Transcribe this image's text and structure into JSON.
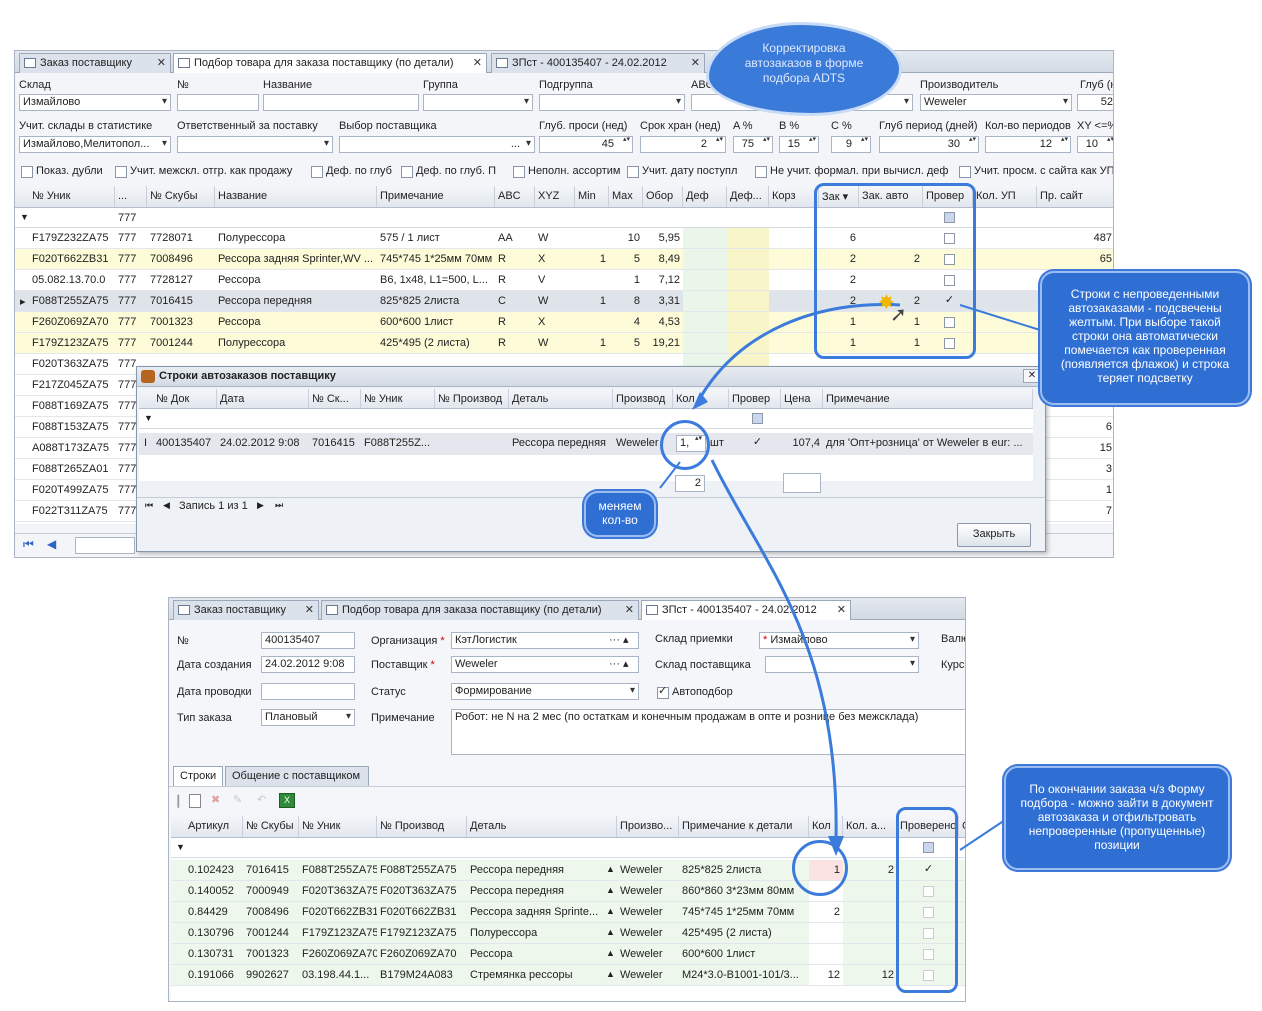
{
  "top_window": {
    "tabs": [
      {
        "label": "Заказ поставщику"
      },
      {
        "label": "Подбор товара для заказа поставщику (по детали)"
      },
      {
        "label": "ЗПст - 400135407 - 24.02.2012"
      }
    ],
    "filters": {
      "sklad_label": "Склад",
      "sklad_value": "Измайлово",
      "num_label": "№",
      "name_label": "Название",
      "group_label": "Группа",
      "subgroup_label": "Подгруппа",
      "abc_label": "ABC",
      "producer_label": "Производитель",
      "producer_value": "Weweler",
      "depth_label": "Глуб (н",
      "depth_value": "52",
      "stat_label": "Учит. склады в статистике",
      "stat_value": "Измайлово,Мелитопол...",
      "resp_label": "Ответственный за поставку",
      "supplier_label": "Выбор поставщика",
      "supplier_value": "...",
      "glub_label": "Глуб. проси (нед)",
      "glub_value": "45",
      "srok_label": "Срок хран (нед)",
      "srok_value": "2",
      "a_label": "A %",
      "a_value": "75",
      "b_label": "B %",
      "b_value": "15",
      "c_label": "C %",
      "c_value": "9",
      "period_label": "Глуб период (дней)",
      "period_value": "30",
      "periods_label": "Кол-во периодов",
      "periods_value": "12",
      "xy_label": "XY <=%",
      "xy_value": "10"
    },
    "checkboxes": [
      "Показ. дубли",
      "Учит. межскл. отгр. как продажу",
      "Деф. по глуб",
      "Деф. по глуб. П",
      "Неполн. ассортим",
      "Учит. дату поступл",
      "Не учит. формал. при вычисл. деф",
      "Учит. просм. с сайта как УП"
    ],
    "grid": {
      "headers": [
        "№ Уник",
        "...",
        "№ Скубы",
        "Название",
        "Примечание",
        "ABC",
        "XYZ",
        "Min",
        "Max",
        "Обор",
        "Деф",
        "Деф...",
        "Корз",
        "Зак",
        "Зак. авто",
        "Провер",
        "Кол. УП",
        "Пр. сайт"
      ],
      "filter_value": "777",
      "rows": [
        {
          "uid": "F179Z232ZA75",
          "n": "777",
          "sku": "7728071",
          "name": "Полурессора",
          "note": "575 / 1 лист",
          "abc": "AA",
          "xyz": "W",
          "min": "",
          "max": "10",
          "obor": "5,95",
          "zak": "6",
          "auto": "",
          "check": false,
          "site": "487"
        },
        {
          "uid": "F020T662ZB31",
          "n": "777",
          "sku": "7008496",
          "name": "Рессора задняя Sprinter,WV ...",
          "note": "745*745 1*25мм 70мм",
          "abc": "R",
          "xyz": "X",
          "min": "1",
          "max": "5",
          "obor": "8,49",
          "zak": "2",
          "auto": "2",
          "check": false,
          "site": "65"
        },
        {
          "uid": "05.082.13.70.0",
          "n": "777",
          "sku": "7728127",
          "name": "Рессора",
          "note": "B6, 1x48, L1=500, L...",
          "abc": "R",
          "xyz": "V",
          "min": "",
          "max": "1",
          "obor": "7,12",
          "zak": "2",
          "auto": "",
          "check": false,
          "site": ""
        },
        {
          "uid": "F088T255ZA75",
          "n": "777",
          "sku": "7016415",
          "name": "Рессора передняя",
          "note": "825*825 2листа",
          "abc": "C",
          "xyz": "W",
          "min": "1",
          "max": "8",
          "obor": "3,31",
          "zak": "2",
          "auto": "2",
          "check": true,
          "site": ""
        },
        {
          "uid": "F260Z069ZA70",
          "n": "777",
          "sku": "7001323",
          "name": "Рессора",
          "note": "600*600 1лист",
          "abc": "R",
          "xyz": "X",
          "min": "",
          "max": "4",
          "obor": "4,53",
          "zak": "1",
          "auto": "1",
          "check": false,
          "site": ""
        },
        {
          "uid": "F179Z123ZA75",
          "n": "777",
          "sku": "7001244",
          "name": "Полурессора",
          "note": "425*495 (2 листа)",
          "abc": "R",
          "xyz": "W",
          "min": "1",
          "max": "5",
          "obor": "19,21",
          "zak": "1",
          "auto": "1",
          "check": false,
          "site": ""
        },
        {
          "uid": "F020T363ZA75",
          "n": "777",
          "site": ""
        },
        {
          "uid": "F217Z045ZA75",
          "n": "777",
          "site": ""
        },
        {
          "uid": "F088T169ZA75",
          "n": "777",
          "site": ""
        },
        {
          "uid": "F088T153ZA75",
          "n": "777",
          "site": "6"
        },
        {
          "uid": "A088T173ZA75",
          "n": "777",
          "site": "15"
        },
        {
          "uid": "F088T265ZA01",
          "n": "777",
          "site": "3"
        },
        {
          "uid": "F020T499ZA75",
          "n": "777",
          "site": "1"
        },
        {
          "uid": "F022T311ZA75",
          "n": "777",
          "site": "7"
        }
      ]
    }
  },
  "dialog": {
    "title": "Строки автозаказов поставщику",
    "headers": [
      "№ Док",
      "Дата",
      "№ Ск...",
      "№ Уник",
      "№ Производ",
      "Деталь",
      "Производ",
      "Кол",
      "Провер",
      "Цена",
      "Примечание"
    ],
    "row": {
      "doc": "400135407",
      "date": "24.02.2012 9:08",
      "sku": "7016415",
      "uid": "F088T255Z...",
      "part": "Рессора передняя",
      "prod": "Weweler",
      "qty": "1,",
      "unit": "шт",
      "price": "107,4",
      "note": "для 'Опт+розница' от Weweler в eur: ..."
    },
    "total": "2",
    "nav": "Запись 1 из 1",
    "close_label": "Закрыть"
  },
  "doc_window": {
    "tabs": [
      {
        "label": "Заказ поставщику"
      },
      {
        "label": "Подбор товара для заказа поставщику (по детали)"
      },
      {
        "label": "ЗПст - 400135407 - 24.02.2012"
      }
    ],
    "fields": {
      "num_label": "№",
      "num_value": "400135407",
      "created_label": "Дата создания",
      "created_value": "24.02.2012 9:08",
      "posted_label": "Дата проводки",
      "type_label": "Тип заказа",
      "type_value": "Плановый",
      "org_label": "Организация",
      "org_value": "КэтЛогистик",
      "supplier_label": "Поставщик",
      "supplier_value": "Weweler",
      "status_label": "Статус",
      "status_value": "Формирование",
      "note_label": "Примечание",
      "note_value": "Робот: не N на 2 мес (по остаткам и конечным продажам в опте и рознице без межсклада)",
      "recv_label": "Склад приемки",
      "recv_value": "Измайлово",
      "supwh_label": "Склад поставщика",
      "auto_label": "Автоподбор",
      "val_label": "Валю",
      "rate_label": "Курс"
    },
    "subtabs": [
      "Строки",
      "Общение с поставщиком"
    ],
    "grid": {
      "headers": [
        "Артикул",
        "№ Скубы",
        "№ Уник",
        "№ Производ",
        "Деталь",
        "Произво...",
        "Примечание к детали",
        "Кол",
        "Кол. а...",
        "Проверено",
        "С"
      ],
      "rows": [
        {
          "art": "0.102423",
          "sku": "7016415",
          "uid": "F088T255ZA75",
          "prod_no": "F088T255ZA75",
          "part": "Рессора передняя",
          "prod": "Weweler",
          "note": "825*825 2листа",
          "qty": "1",
          "auto": "2",
          "check": true
        },
        {
          "art": "0.140052",
          "sku": "7000949",
          "uid": "F020T363ZA75",
          "prod_no": "F020T363ZA75",
          "part": "Рессора передняя",
          "prod": "Weweler",
          "note": "860*860 3*23мм 80мм",
          "qty": "",
          "auto": "",
          "check": false
        },
        {
          "art": "0.84429",
          "sku": "7008496",
          "uid": "F020T662ZB31",
          "prod_no": "F020T662ZB31",
          "part": "Рессора задняя Sprinte...",
          "prod": "Weweler",
          "note": "745*745 1*25мм 70мм",
          "qty": "2",
          "auto": "",
          "check": false
        },
        {
          "art": "0.130796",
          "sku": "7001244",
          "uid": "F179Z123ZA75",
          "prod_no": "F179Z123ZA75",
          "part": "Полурессора",
          "prod": "Weweler",
          "note": "425*495 (2 листа)",
          "qty": "",
          "auto": "",
          "check": false
        },
        {
          "art": "0.130731",
          "sku": "7001323",
          "uid": "F260Z069ZA70",
          "prod_no": "F260Z069ZA70",
          "part": "Рессора",
          "prod": "Weweler",
          "note": "600*600 1лист",
          "qty": "",
          "auto": "",
          "check": false
        },
        {
          "art": "0.191066",
          "sku": "9902627",
          "uid": "03.198.44.1...",
          "prod_no": "B179M24A083",
          "part": "Стремянка рессоры",
          "prod": "Weweler",
          "note": "M24*3.0-B1001-101/3...",
          "qty": "12",
          "auto": "12",
          "check": false
        }
      ]
    }
  },
  "annotations": {
    "cloud": "Корректировка автозаказов в форме подбора ADTS",
    "callout_rows": "Строки с непроведенными автозаказами - подсвечены желтым. При выборе такой строки она автоматически помечается как проверенная (появляется флажок) и строка теряет подсветку",
    "callout_qty": "меняем кол-во",
    "callout_after": "По окончании заказа ч/з Форму подбора - можно зайти в документ автозаказа и отфильтровать непроверенные (пропущенные) позиции"
  }
}
